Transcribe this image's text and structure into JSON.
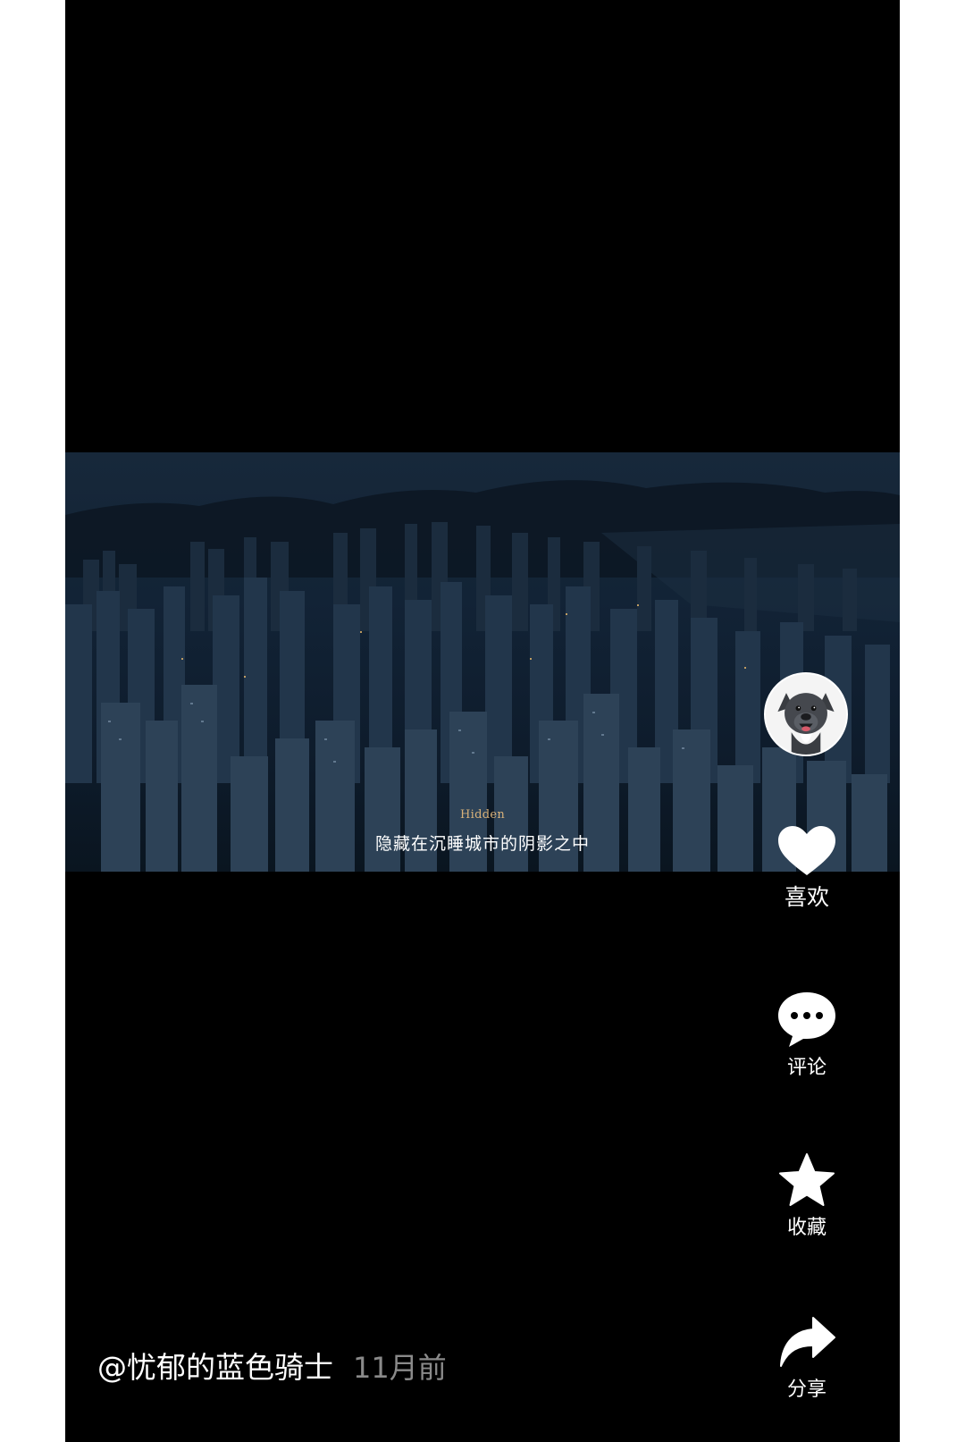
{
  "video": {
    "subtitle_en": "Hidden",
    "subtitle_cn": "隐藏在沉睡城市的阴影之中"
  },
  "actions": {
    "like_label": "喜欢",
    "comment_label": "评论",
    "favorite_label": "收藏",
    "share_label": "分享"
  },
  "post": {
    "author": "@忧郁的蓝色骑士",
    "time": "11月前"
  },
  "icons": {
    "like": "heart-icon",
    "comment": "comment-bubble-icon",
    "favorite": "star-icon",
    "share": "share-arrow-icon"
  },
  "colors": {
    "background": "#000000",
    "subtitle_en": "#d9b27a",
    "time_text": "#8a8a8a"
  }
}
